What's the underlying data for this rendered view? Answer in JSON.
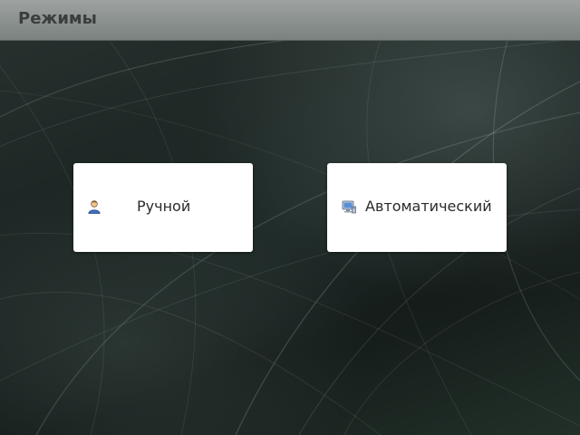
{
  "header": {
    "title": "Режимы"
  },
  "modes": [
    {
      "label": "Ручной",
      "icon": "user-icon"
    },
    {
      "label": "Автоматический",
      "icon": "computer-icon"
    }
  ],
  "colors": {
    "header_bg": "#8a908e",
    "header_text": "#3a3f3e",
    "button_bg": "#ffffff",
    "button_text": "#2b2b2b"
  }
}
